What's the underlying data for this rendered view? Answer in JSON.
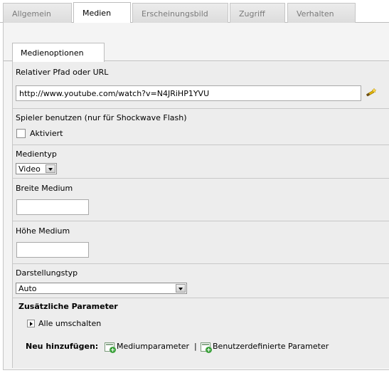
{
  "top_tabs": [
    "Allgemein",
    "Medien",
    "Erscheinungsbild",
    "Zugriff",
    "Verhalten"
  ],
  "sub_tab": "Medienoptionen",
  "path": {
    "label": "Relativer Pfad oder URL",
    "value": "http://www.youtube.com/watch?v=N4JRiHP1YVU",
    "icon": "wizard-wand-icon"
  },
  "player": {
    "label": "Spieler benutzen (nur für Shockwave Flash)",
    "checkbox_label": "Aktiviert",
    "checked": false
  },
  "media_type": {
    "label": "Medientyp",
    "selected": "Video"
  },
  "width": {
    "label": "Breite Medium",
    "value": ""
  },
  "height": {
    "label": "Höhe Medium",
    "value": ""
  },
  "display_type": {
    "label": "Darstellungstyp",
    "selected": "Auto"
  },
  "extra_params": {
    "title": "Zusätzliche Parameter",
    "toggle_label": "Alle umschalten"
  },
  "add_new": {
    "label": "Neu hinzufügen:",
    "medium_params": "Mediumparameter",
    "separator": "|",
    "custom_params": "Benutzerdefinierte Parameter"
  },
  "colors": {
    "accent_green": "#3da23d",
    "wand_yellow": "#e2b400"
  }
}
